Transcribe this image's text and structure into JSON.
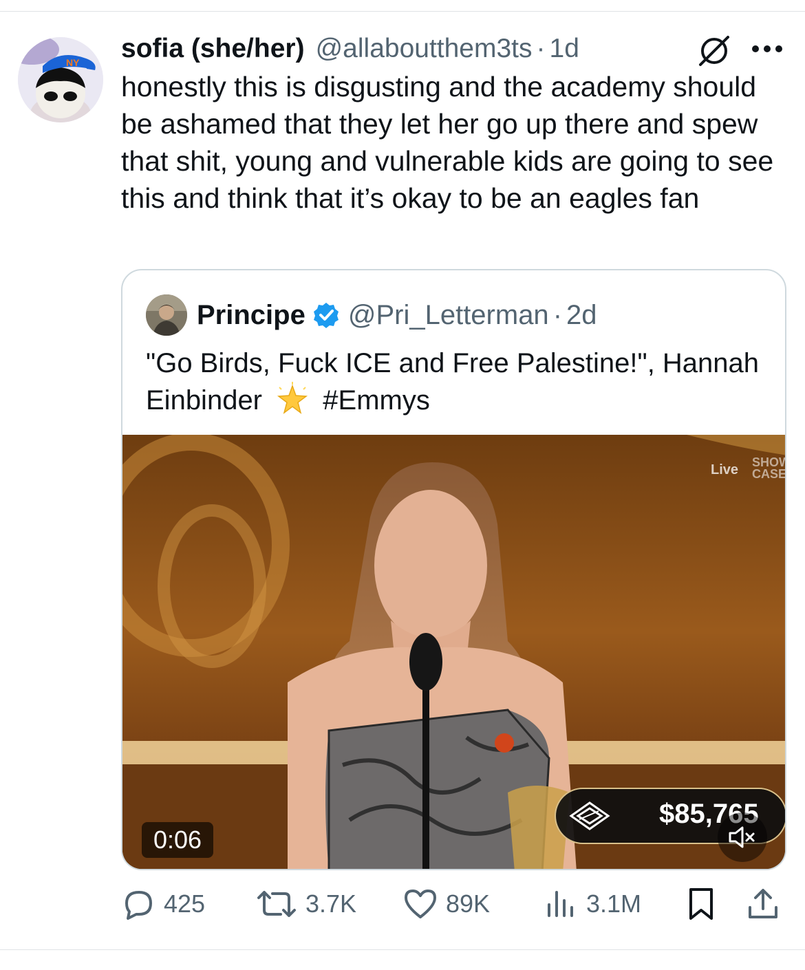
{
  "tweet": {
    "display_name": "sofia (she/her)",
    "handle": "@allaboutthem3ts",
    "separator": "·",
    "time": "1d",
    "text": "honestly this is disgusting and the academy should be ashamed that they let her go up there and spew that shit, young and vulnerable kids are going to see this and think that it’s okay to be an eagles fan"
  },
  "quote": {
    "display_name": "Principe",
    "handle": "@Pri_Letterman",
    "separator": "·",
    "time": "2d",
    "text_main": "\"Go Birds, Fuck ICE and Free Palestine!\", Hannah Einbinder",
    "hashtag": "#Emmys",
    "sparkle_icon": "glowing-star-emoji"
  },
  "video": {
    "timer": "0:06",
    "overlay_live": "Live",
    "overlay_show": "SHOW CASE",
    "donation_amount": "$85,765",
    "mute_icon": "speaker-muted-icon"
  },
  "actions": {
    "replies": "425",
    "reposts": "3.7K",
    "likes": "89K",
    "views": "3.1M"
  },
  "colors": {
    "text": "#0f1419",
    "secondary": "#536471",
    "verified": "#1d9bf0",
    "border": "#cfd9de"
  }
}
